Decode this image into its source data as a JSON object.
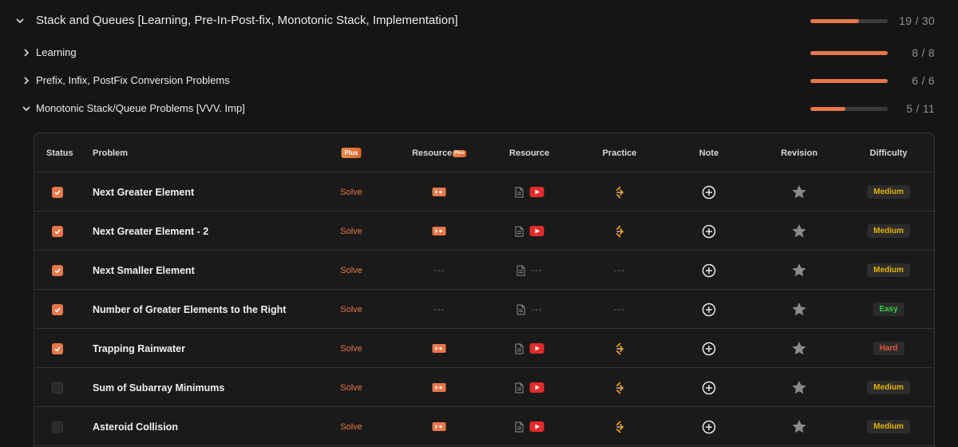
{
  "sections": [
    {
      "title": "Stack and Queues [Learning, Pre-In-Post-fix, Monotonic Stack, Implementation]",
      "expanded": true,
      "done": 19,
      "total": 30,
      "count": "19 / 30",
      "progress": 0.633
    },
    {
      "title": "Learning",
      "expanded": false,
      "done": 8,
      "total": 8,
      "count": "8 / 8",
      "progress": 1.0
    },
    {
      "title": "Prefix, Infix, PostFix Conversion Problems",
      "expanded": false,
      "done": 6,
      "total": 6,
      "count": "6 / 6",
      "progress": 1.0
    },
    {
      "title": "Monotonic Stack/Queue Problems [VVV. Imp]",
      "expanded": true,
      "done": 5,
      "total": 11,
      "count": "5 / 11",
      "progress": 0.455
    }
  ],
  "table": {
    "headers": {
      "status": "Status",
      "problem": "Problem",
      "plus": "Plus",
      "resource_plus": "Resource",
      "resource_plus_badge": "Plus",
      "resource": "Resource",
      "practice": "Practice",
      "note": "Note",
      "revision": "Revision",
      "difficulty": "Difficulty"
    },
    "rows": [
      {
        "checked": true,
        "problem": "Next Greater Element",
        "solve": "Solve",
        "has_plus_video": true,
        "has_youtube": true,
        "has_practice": true,
        "dash": "---",
        "difficulty": "Medium"
      },
      {
        "checked": true,
        "problem": "Next Greater Element - 2",
        "solve": "Solve",
        "has_plus_video": true,
        "has_youtube": true,
        "has_practice": true,
        "dash": "---",
        "difficulty": "Medium"
      },
      {
        "checked": true,
        "problem": "Next Smaller Element",
        "solve": "Solve",
        "has_plus_video": false,
        "has_youtube": false,
        "has_practice": false,
        "dash": "---",
        "difficulty": "Medium"
      },
      {
        "checked": true,
        "problem": "Number of Greater Elements to the Right",
        "solve": "Solve",
        "has_plus_video": false,
        "has_youtube": false,
        "has_practice": false,
        "dash": "---",
        "difficulty": "Easy"
      },
      {
        "checked": true,
        "problem": "Trapping Rainwater",
        "solve": "Solve",
        "has_plus_video": true,
        "has_youtube": true,
        "has_practice": true,
        "dash": "---",
        "difficulty": "Hard"
      },
      {
        "checked": false,
        "problem": "Sum of Subarray Minimums",
        "solve": "Solve",
        "has_plus_video": true,
        "has_youtube": true,
        "has_practice": true,
        "dash": "---",
        "difficulty": "Medium"
      },
      {
        "checked": false,
        "problem": "Asteroid Collision",
        "solve": "Solve",
        "has_plus_video": true,
        "has_youtube": true,
        "has_practice": true,
        "dash": "---",
        "difficulty": "Medium"
      }
    ]
  },
  "difficulty_colors": {
    "Medium": "#e6b400",
    "Easy": "#2ecc40",
    "Hard": "#e5533d"
  },
  "colors": {
    "accent": "#e8774a",
    "youtube": "#e22b2b",
    "background": "#151515"
  },
  "icons": {
    "collapse": "chevron-down-icon",
    "expand": "chevron-right-icon",
    "status": "check-icon",
    "plus_video": "plus-video-icon",
    "article": "article-icon",
    "youtube": "youtube-icon",
    "practice": "practice-icon",
    "note": "add-note-icon",
    "revision": "star-icon"
  }
}
